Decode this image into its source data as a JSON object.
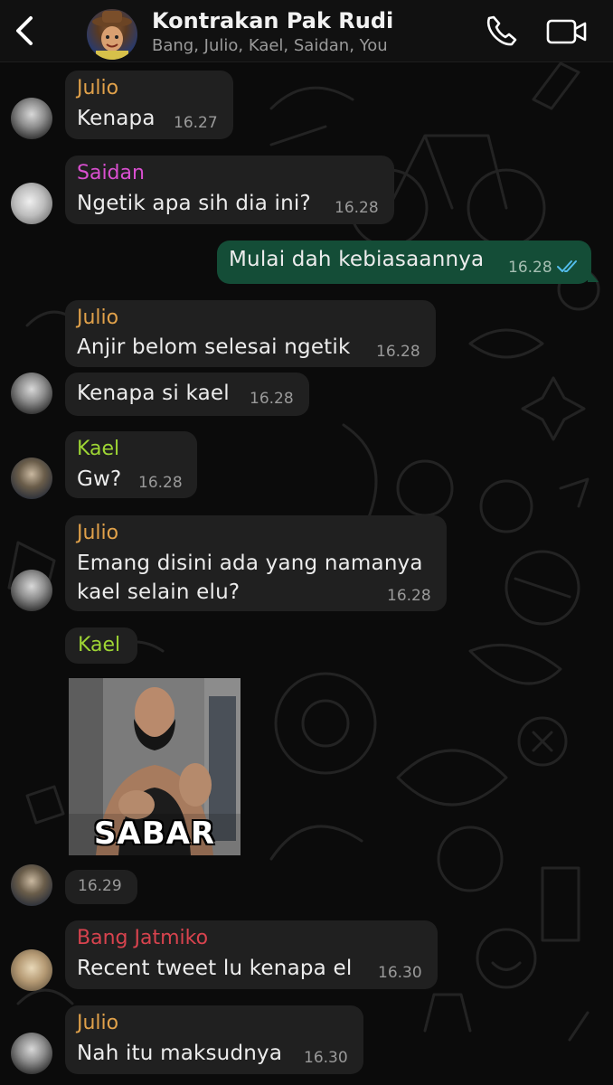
{
  "header": {
    "title": "Kontrakan Pak Rudi",
    "participants": "Bang, Julio, Kael, Saidan, You"
  },
  "colors": {
    "julio": "#e0a14a",
    "saidan": "#d94fd0",
    "kael": "#9ed534",
    "bang": "#d8434e",
    "outgoing_bubble": "#144d37",
    "incoming_bubble": "#202020",
    "read_ticks": "#53bdeb"
  },
  "messages": [
    {
      "sender": "Julio",
      "text": "Kenapa",
      "time": "16.27"
    },
    {
      "sender": "Saidan",
      "text": "Ngetik apa sih dia ini?",
      "time": "16.28"
    },
    {
      "sender": "You",
      "text": "Mulai dah kebiasaannya",
      "time": "16.28",
      "status": "read"
    },
    {
      "sender": "Julio",
      "text": "Anjir belom selesai ngetik",
      "time": "16.28"
    },
    {
      "sender": "Julio",
      "text": "Kenapa si kael",
      "time": "16.28"
    },
    {
      "sender": "Kael",
      "text": "Gw?",
      "time": "16.28"
    },
    {
      "sender": "Julio",
      "text_line1": "Emang disini ada yang namanya",
      "text_line2": "kael selain elu?",
      "time": "16.28"
    },
    {
      "sender": "Kael",
      "sticker_text": "SABAR",
      "time": "16.29"
    },
    {
      "sender": "Bang Jatmiko",
      "text": "Recent tweet lu kenapa el",
      "time": "16.30"
    },
    {
      "sender": "Julio",
      "text": "Nah itu maksudnya",
      "time": "16.30"
    }
  ]
}
